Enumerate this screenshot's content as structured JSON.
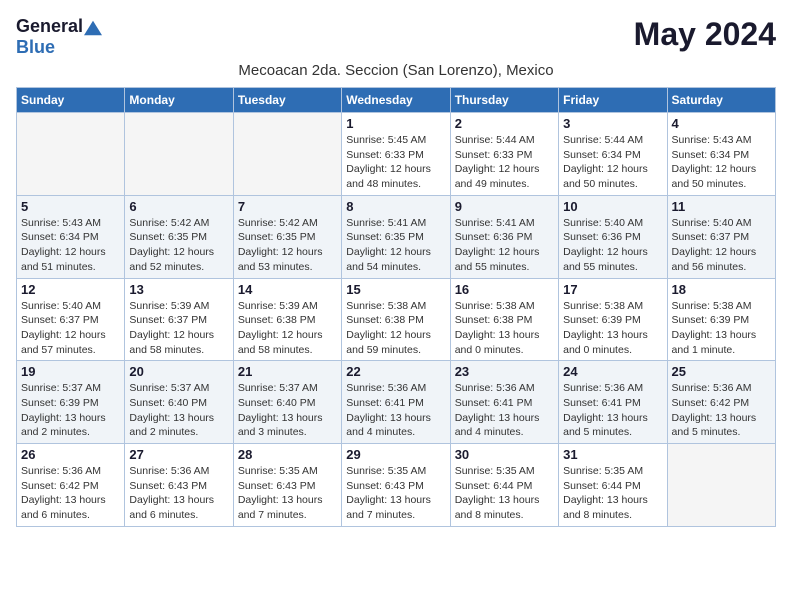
{
  "header": {
    "logo_general": "General",
    "logo_blue": "Blue",
    "month_title": "May 2024",
    "subtitle": "Mecoacan 2da. Seccion (San Lorenzo), Mexico"
  },
  "weekdays": [
    "Sunday",
    "Monday",
    "Tuesday",
    "Wednesday",
    "Thursday",
    "Friday",
    "Saturday"
  ],
  "weeks": [
    [
      {
        "day": "",
        "info": ""
      },
      {
        "day": "",
        "info": ""
      },
      {
        "day": "",
        "info": ""
      },
      {
        "day": "1",
        "info": "Sunrise: 5:45 AM\nSunset: 6:33 PM\nDaylight: 12 hours\nand 48 minutes."
      },
      {
        "day": "2",
        "info": "Sunrise: 5:44 AM\nSunset: 6:33 PM\nDaylight: 12 hours\nand 49 minutes."
      },
      {
        "day": "3",
        "info": "Sunrise: 5:44 AM\nSunset: 6:34 PM\nDaylight: 12 hours\nand 50 minutes."
      },
      {
        "day": "4",
        "info": "Sunrise: 5:43 AM\nSunset: 6:34 PM\nDaylight: 12 hours\nand 50 minutes."
      }
    ],
    [
      {
        "day": "5",
        "info": "Sunrise: 5:43 AM\nSunset: 6:34 PM\nDaylight: 12 hours\nand 51 minutes."
      },
      {
        "day": "6",
        "info": "Sunrise: 5:42 AM\nSunset: 6:35 PM\nDaylight: 12 hours\nand 52 minutes."
      },
      {
        "day": "7",
        "info": "Sunrise: 5:42 AM\nSunset: 6:35 PM\nDaylight: 12 hours\nand 53 minutes."
      },
      {
        "day": "8",
        "info": "Sunrise: 5:41 AM\nSunset: 6:35 PM\nDaylight: 12 hours\nand 54 minutes."
      },
      {
        "day": "9",
        "info": "Sunrise: 5:41 AM\nSunset: 6:36 PM\nDaylight: 12 hours\nand 55 minutes."
      },
      {
        "day": "10",
        "info": "Sunrise: 5:40 AM\nSunset: 6:36 PM\nDaylight: 12 hours\nand 55 minutes."
      },
      {
        "day": "11",
        "info": "Sunrise: 5:40 AM\nSunset: 6:37 PM\nDaylight: 12 hours\nand 56 minutes."
      }
    ],
    [
      {
        "day": "12",
        "info": "Sunrise: 5:40 AM\nSunset: 6:37 PM\nDaylight: 12 hours\nand 57 minutes."
      },
      {
        "day": "13",
        "info": "Sunrise: 5:39 AM\nSunset: 6:37 PM\nDaylight: 12 hours\nand 58 minutes."
      },
      {
        "day": "14",
        "info": "Sunrise: 5:39 AM\nSunset: 6:38 PM\nDaylight: 12 hours\nand 58 minutes."
      },
      {
        "day": "15",
        "info": "Sunrise: 5:38 AM\nSunset: 6:38 PM\nDaylight: 12 hours\nand 59 minutes."
      },
      {
        "day": "16",
        "info": "Sunrise: 5:38 AM\nSunset: 6:38 PM\nDaylight: 13 hours\nand 0 minutes."
      },
      {
        "day": "17",
        "info": "Sunrise: 5:38 AM\nSunset: 6:39 PM\nDaylight: 13 hours\nand 0 minutes."
      },
      {
        "day": "18",
        "info": "Sunrise: 5:38 AM\nSunset: 6:39 PM\nDaylight: 13 hours\nand 1 minute."
      }
    ],
    [
      {
        "day": "19",
        "info": "Sunrise: 5:37 AM\nSunset: 6:39 PM\nDaylight: 13 hours\nand 2 minutes."
      },
      {
        "day": "20",
        "info": "Sunrise: 5:37 AM\nSunset: 6:40 PM\nDaylight: 13 hours\nand 2 minutes."
      },
      {
        "day": "21",
        "info": "Sunrise: 5:37 AM\nSunset: 6:40 PM\nDaylight: 13 hours\nand 3 minutes."
      },
      {
        "day": "22",
        "info": "Sunrise: 5:36 AM\nSunset: 6:41 PM\nDaylight: 13 hours\nand 4 minutes."
      },
      {
        "day": "23",
        "info": "Sunrise: 5:36 AM\nSunset: 6:41 PM\nDaylight: 13 hours\nand 4 minutes."
      },
      {
        "day": "24",
        "info": "Sunrise: 5:36 AM\nSunset: 6:41 PM\nDaylight: 13 hours\nand 5 minutes."
      },
      {
        "day": "25",
        "info": "Sunrise: 5:36 AM\nSunset: 6:42 PM\nDaylight: 13 hours\nand 5 minutes."
      }
    ],
    [
      {
        "day": "26",
        "info": "Sunrise: 5:36 AM\nSunset: 6:42 PM\nDaylight: 13 hours\nand 6 minutes."
      },
      {
        "day": "27",
        "info": "Sunrise: 5:36 AM\nSunset: 6:43 PM\nDaylight: 13 hours\nand 6 minutes."
      },
      {
        "day": "28",
        "info": "Sunrise: 5:35 AM\nSunset: 6:43 PM\nDaylight: 13 hours\nand 7 minutes."
      },
      {
        "day": "29",
        "info": "Sunrise: 5:35 AM\nSunset: 6:43 PM\nDaylight: 13 hours\nand 7 minutes."
      },
      {
        "day": "30",
        "info": "Sunrise: 5:35 AM\nSunset: 6:44 PM\nDaylight: 13 hours\nand 8 minutes."
      },
      {
        "day": "31",
        "info": "Sunrise: 5:35 AM\nSunset: 6:44 PM\nDaylight: 13 hours\nand 8 minutes."
      },
      {
        "day": "",
        "info": ""
      }
    ]
  ]
}
